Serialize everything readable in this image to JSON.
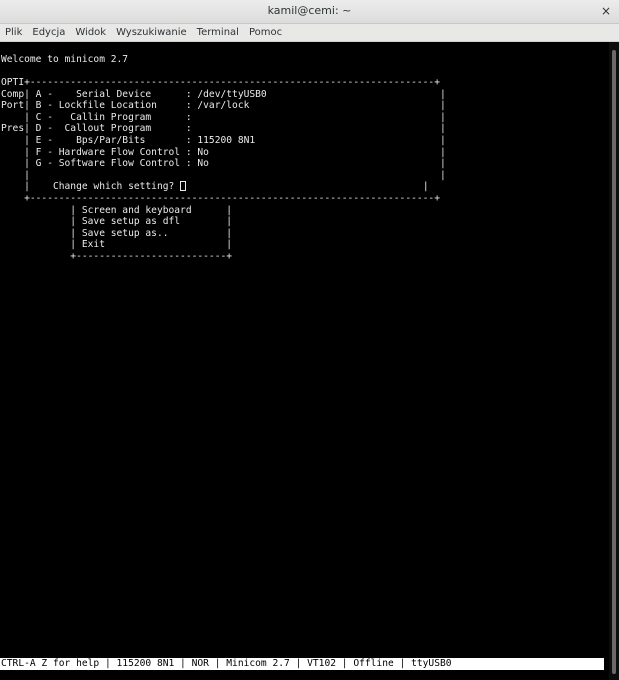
{
  "window": {
    "title": "kamil@cemi: ~",
    "close_glyph": "×"
  },
  "menubar": {
    "items": [
      "Plik",
      "Edycja",
      "Widok",
      "Wyszukiwanie",
      "Terminal",
      "Pomoc"
    ]
  },
  "terminal": {
    "welcome": "Welcome to minicom 2.7",
    "config_box": {
      "top_border": "OPTI+----------------------------------------------------------------------+",
      "rows": [
        "Comp| A -    Serial Device      : /dev/ttyUSB0                              |",
        "Port| B - Lockfile Location     : /var/lock                                 |",
        "    | C -   Callin Program      :                                           |",
        "Pres| D -  Callout Program      :                                           |",
        "    | E -    Bps/Par/Bits       : 115200 8N1                                |",
        "    | F - Hardware Flow Control : No                                        |",
        "    | G - Software Flow Control : No                                        |",
        "    |                                                                       |"
      ],
      "prompt_prefix": "    |    Change which setting? ",
      "prompt_suffix": "                                         |",
      "bottom_border": "    +----------------------------------------------------------------------+"
    },
    "menu_rows": [
      "            | Screen and keyboard      |",
      "            | Save setup as dfl        |",
      "            | Save setup as..          |",
      "            | Exit                     |",
      "            +--------------------------+"
    ]
  },
  "statusbar": {
    "text": "CTRL-A Z for help | 115200 8N1 | NOR | Minicom 2.7 | VT102 | Offline | ttyUSB0"
  }
}
